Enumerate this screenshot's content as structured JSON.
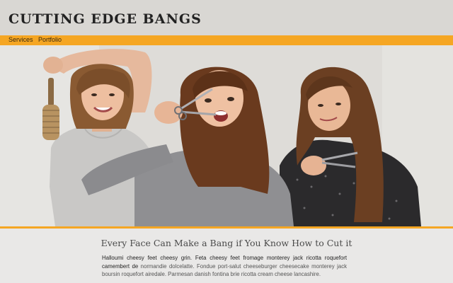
{
  "site": {
    "title": "CUTTING EDGE BANGS"
  },
  "nav": {
    "items": [
      "Services",
      "Portfolio"
    ]
  },
  "hero": {
    "image_description": "photo-three-smiling-stylists-holding-brush-and-scissors"
  },
  "content": {
    "heading": "Every Face Can Make a Bang if You Know How to Cut it",
    "body_lead": "Halloumi cheesy feet cheesy grin. Feta cheesy feet fromage monterey jack ricotta roquefort camembert de",
    "body_rest": "normandie dolcelatte. Fondue port-salut cheeseburger cheesecake monterey jack boursin roquefort airedale. Parmesan danish fontina brie ricotta cream cheese lancashire."
  },
  "colors": {
    "accent": "#f5a623",
    "header_bg": "#d9d7d3",
    "page_bg": "#e9e8e7",
    "title_text": "#222222"
  }
}
